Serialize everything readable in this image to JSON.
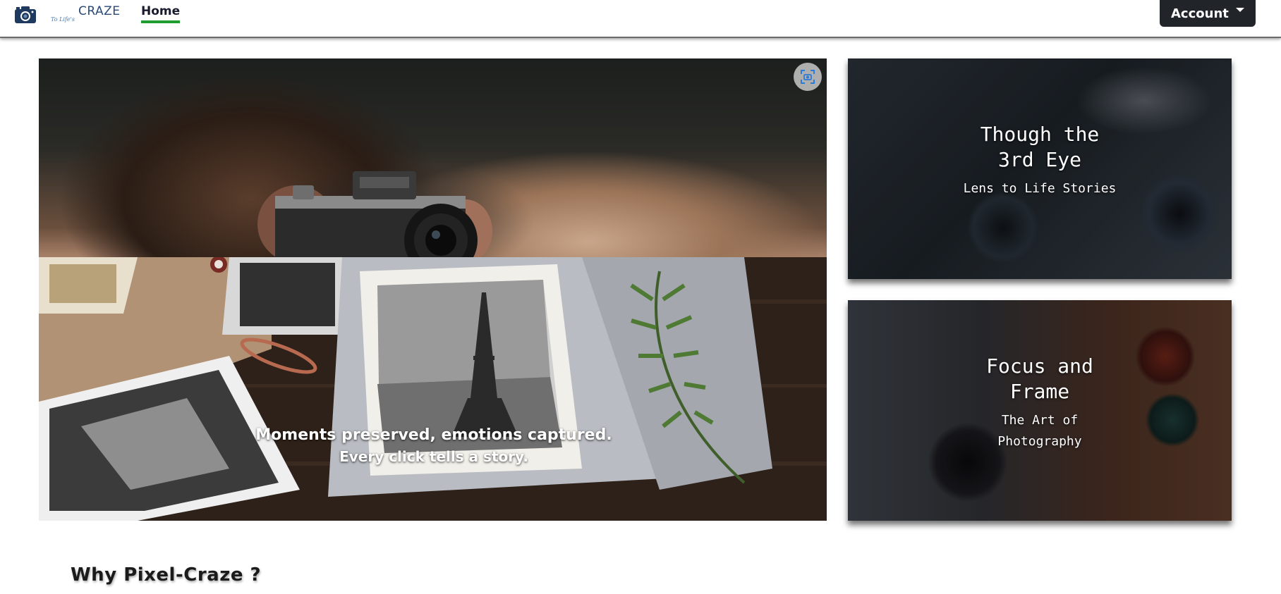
{
  "navbar": {
    "brand_word": "CRAZE",
    "brand_tagline": "To Life's",
    "home_label": "Home",
    "account_label": "Account"
  },
  "hero": {
    "caption_line1": "Moments preserved, emotions captured.",
    "caption_line2": "Every click tells a story."
  },
  "cards": [
    {
      "title": "Though the 3rd Eye",
      "subtitle": "Lens to Life Stories"
    },
    {
      "title": "Focus and Frame",
      "subtitle": "The Art of Photography"
    }
  ],
  "section": {
    "title": "Why Pixel-Craze ?"
  },
  "colors": {
    "nav_active_underline": "#1f9d2e",
    "account_bg": "#212529",
    "brand_blue": "#2a4a78"
  },
  "icons": {
    "brand": "camera-icon",
    "account_caret": "caret-down-icon",
    "screenshot": "screenshot-icon"
  }
}
